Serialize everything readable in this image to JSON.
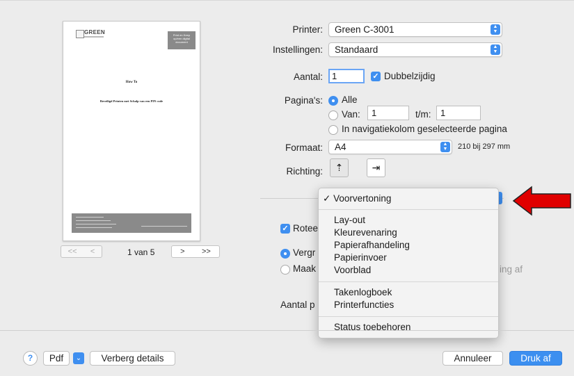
{
  "preview": {
    "logo_text": "GREEN",
    "page_tag": "Print en Keep op/een digital document",
    "page_title": "How To",
    "page_subtitle": "Beveiligd Printen met Schalp van een PIN code",
    "nav_first": "<<",
    "nav_prev": "<",
    "nav_next": ">",
    "nav_last": ">>",
    "page_count": "1 van 5"
  },
  "form": {
    "printer_label": "Printer:",
    "printer_value": "Green C-3001",
    "settings_label": "Instellingen:",
    "settings_value": "Standaard",
    "copies_label": "Aantal:",
    "copies_value": "1",
    "duplex_label": "Dubbelzijdig",
    "pages_label": "Pagina's:",
    "pages_all": "Alle",
    "pages_from": "Van:",
    "pages_from_value": "1",
    "pages_to": "t/m:",
    "pages_to_value": "1",
    "pages_selected": "In navigatiekolom geselecteerde pagina",
    "format_label": "Formaat:",
    "format_value": "A4",
    "format_size": "210 bij 297 mm",
    "orientation_label": "Richting:",
    "rotate_label": "Rotee",
    "scale_label": "Vergr",
    "fit_label": "Maak",
    "fit_suffix": "ing af",
    "copies_per_page_label": "Aantal p"
  },
  "menu": {
    "checked_item": "Voorvertoning",
    "group1": [
      "Lay-out",
      "Kleurevenaring",
      "Papierafhandeling",
      "Papierinvoer",
      "Voorblad"
    ],
    "group2": [
      "Takenlogboek",
      "Printerfuncties"
    ],
    "group3": [
      "Status toebehoren"
    ]
  },
  "footer": {
    "help": "?",
    "pdf": "Pdf",
    "hide_details": "Verberg details",
    "cancel": "Annuleer",
    "print": "Druk af"
  },
  "colors": {
    "accent": "#3f8ff0",
    "arrow": "#e00000"
  }
}
